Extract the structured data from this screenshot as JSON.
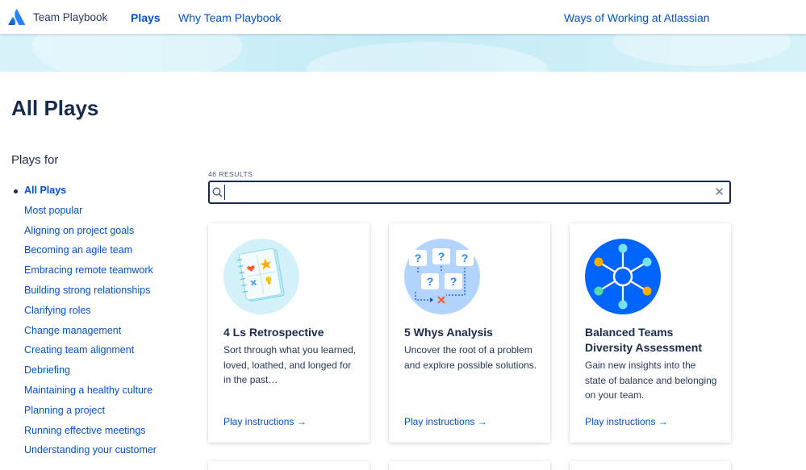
{
  "header": {
    "brand": "Team Playbook",
    "nav": {
      "plays": "Plays",
      "why": "Why Team Playbook"
    },
    "ways": "Ways of Working at Atlassian"
  },
  "page_title": "All Plays",
  "sidebar": {
    "heading": "Plays for",
    "items": [
      {
        "label": "All Plays",
        "active": true
      },
      {
        "label": "Most popular"
      },
      {
        "label": "Aligning on project goals"
      },
      {
        "label": "Becoming an agile team"
      },
      {
        "label": "Embracing remote teamwork"
      },
      {
        "label": "Building strong relationships"
      },
      {
        "label": "Clarifying roles"
      },
      {
        "label": "Change management"
      },
      {
        "label": "Creating team alignment"
      },
      {
        "label": "Debriefing"
      },
      {
        "label": "Maintaining a healthy culture"
      },
      {
        "label": "Planning a project"
      },
      {
        "label": "Running effective meetings"
      },
      {
        "label": "Understanding your customer"
      }
    ]
  },
  "search": {
    "results": "46 RESULTS",
    "value": "",
    "placeholder": ""
  },
  "cards": [
    {
      "title": "4 Ls Retrospective",
      "desc": "Sort through what you learned, loved, loathed, and longed for in the past…",
      "link": "Play instructions →",
      "icon": "notebook-icon"
    },
    {
      "title": "5 Whys Analysis",
      "desc": "Uncover the root of a problem and explore possible solutions.",
      "link": "Play instructions →",
      "icon": "question-cards-icon"
    },
    {
      "title": "Balanced Teams Diversity Assessment",
      "desc": "Gain new insights into the state of balance and belonging on your team.",
      "link": "Play instructions →",
      "icon": "hub-icon"
    }
  ],
  "colors": {
    "link": "#0052cc",
    "text": "#172b4d",
    "hero": "#c4ecf6"
  }
}
